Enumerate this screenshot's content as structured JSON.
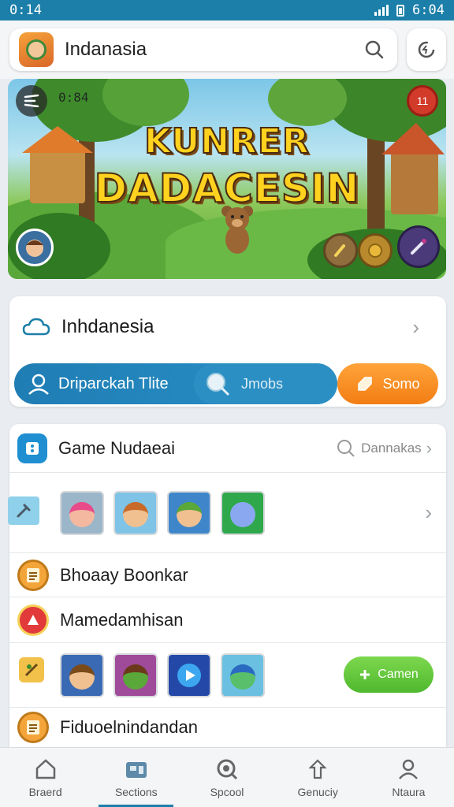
{
  "status": {
    "time_left": "0:14",
    "time_right": "6:04"
  },
  "header": {
    "title": "Indanasia"
  },
  "banner": {
    "title_line1": "KUNRER",
    "title_line2": "DADACESIN",
    "top_left_label": "0:84",
    "top_right_label": "11"
  },
  "card1": {
    "title": "Inhdanesia",
    "seg_primary": "Driparckah Tlite",
    "seg_secondary": "Jmobs",
    "action": "Somo"
  },
  "list": {
    "row1": {
      "title": "Game Nudaeai",
      "right_text": "Dannakas"
    },
    "row3": {
      "title": "Bhoaay Boonkar"
    },
    "row4": {
      "title": "Mamedamhisan"
    },
    "row5": {
      "button": "Camen"
    },
    "row6": {
      "title": "Fiduoelnindandan"
    }
  },
  "nav": [
    {
      "label": "Braerd",
      "icon": "home-icon"
    },
    {
      "label": "Sections",
      "icon": "store-icon"
    },
    {
      "label": "Spcool",
      "icon": "search-icon"
    },
    {
      "label": "Genuciy",
      "icon": "upload-icon"
    },
    {
      "label": "Ntaura",
      "icon": "profile-icon"
    }
  ],
  "colors": {
    "accent": "#1b7fa9",
    "orange": "#f68a1f",
    "green": "#5cc43a"
  }
}
